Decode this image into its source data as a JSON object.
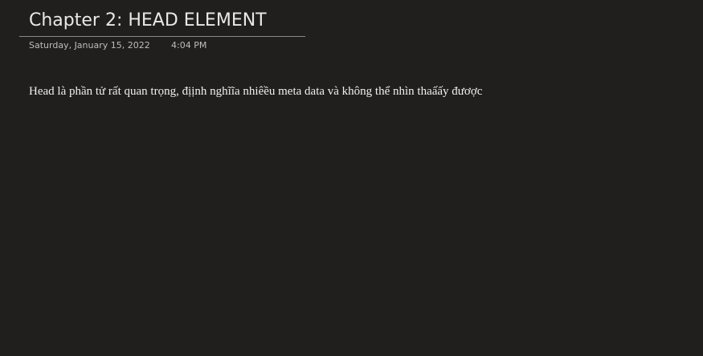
{
  "page": {
    "title": "Chapter 2: HEAD ELEMENT",
    "date": "Saturday, January 15, 2022",
    "time": "4:04 PM"
  },
  "content": {
    "paragraph": "Head là phần tử rất quan trọng, địịnh nghĩĩa nhiêều meta data và không thể nhìn thaấấy đươợc"
  },
  "colors": {
    "background": "#201f1e",
    "text": "#f0f0f0",
    "rule": "#8a8886"
  }
}
